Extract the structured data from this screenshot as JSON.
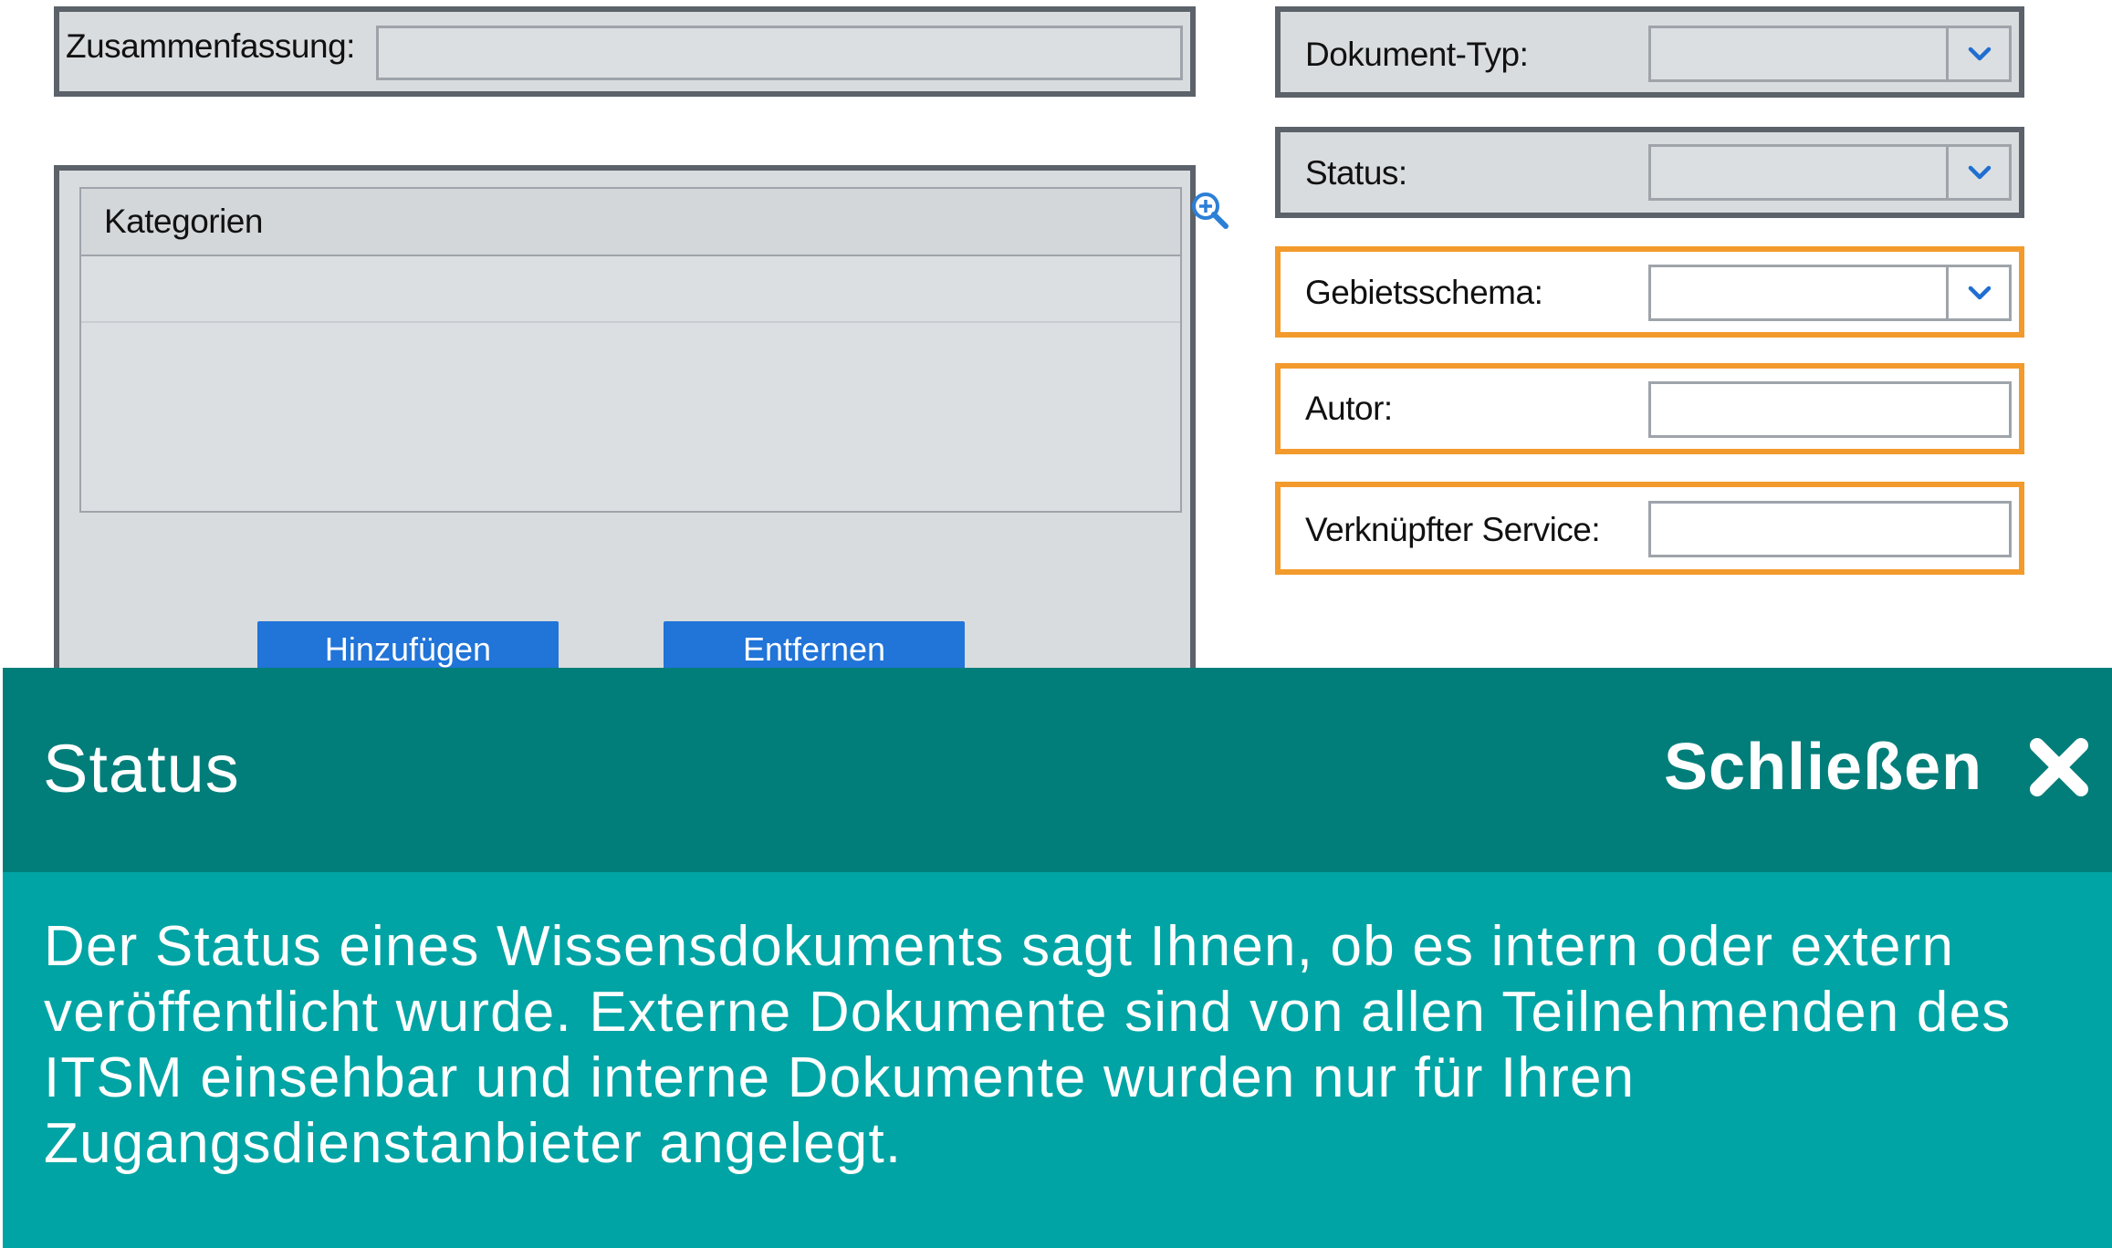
{
  "form": {
    "summary_label": "Zusammenfassung:",
    "summary_value": "",
    "categories": {
      "header": "Kategorien",
      "add_button": "Hinzufügen",
      "remove_button": "Entfernen"
    },
    "fields": {
      "document_type_label": "Dokument-Typ:",
      "document_type_value": "",
      "status_label": "Status:",
      "status_value": "",
      "locale_label": "Gebietsschema:",
      "locale_value": "",
      "author_label": "Autor:",
      "author_value": "",
      "linked_service_label": "Verknüpfter Service:",
      "linked_service_value": ""
    }
  },
  "tooltip": {
    "title": "Status",
    "close_label": "Schließen",
    "body": "Der Status eines Wissensdokuments sagt Ihnen, ob es intern oder extern veröffentlicht wurde. Externe Dokumente sind von allen Teilnehmenden des ITSM einsehbar und interne Dokumente wurden nur für Ihren Zugangsdienstanbieter angelegt."
  },
  "colors": {
    "highlight_border": "#f39a2c",
    "field_border": "#5b6269",
    "button_blue": "#2174d8",
    "tooltip_header": "#017e7a",
    "tooltip_body": "#00a4a4"
  },
  "icons": {
    "zoom": "zoom-in-icon",
    "chevron": "chevron-down-icon",
    "close": "close-icon"
  }
}
